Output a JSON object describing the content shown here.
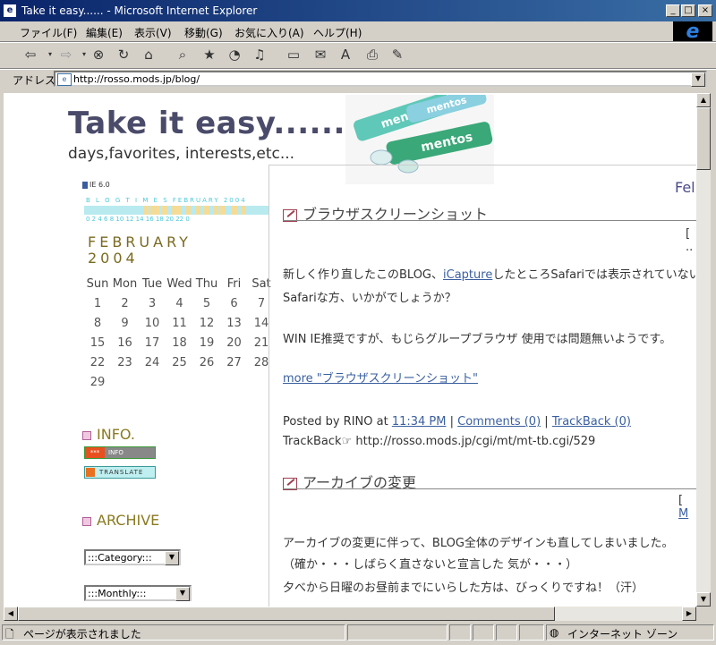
{
  "window": {
    "title": "Take it easy...... - Microsoft Internet Explorer"
  },
  "menu": [
    "ファイル(F)",
    "編集(E)",
    "表示(V)",
    "移動(G)",
    "お気に入り(A)",
    "ヘルプ(H)"
  ],
  "address": {
    "label": "アドレス",
    "url": "http://rosso.mods.jp/blog/"
  },
  "blog": {
    "title": "Take it easy........",
    "subtitle": "days,favorites, interests,etc...",
    "header_image_text": [
      "mentos",
      "mentos",
      "mentos"
    ]
  },
  "sidebar": {
    "ie_badge": "IE 6.0",
    "blogtimes_label": "B L O G T I M E S   FEBRUARY 2004",
    "blogtimes_hours": "0 2 4 6 8 10 12 14 16 18 20 22 0",
    "blogtimes_activity": [
      0.32,
      0.36,
      0.38,
      0.42,
      0.47,
      0.5,
      0.55,
      0.6,
      0.65,
      0.7,
      0.74,
      0.8,
      0.85
    ],
    "calendar_month": "FEBRUARY",
    "calendar_year": "2004",
    "calendar_days": [
      "Sun",
      "Mon",
      "Tue",
      "Wed",
      "Thu",
      "Fri",
      "Sat"
    ],
    "calendar_weeks": [
      [
        "1",
        "2",
        "3",
        "4",
        "5",
        "6",
        "7"
      ],
      [
        "8",
        "9",
        "10",
        "11",
        "12",
        "13",
        "14"
      ],
      [
        "15",
        "16",
        "17",
        "18",
        "19",
        "20",
        "21"
      ],
      [
        "22",
        "23",
        "24",
        "25",
        "26",
        "27",
        "28"
      ],
      [
        "29",
        "",
        "",
        "",
        "",
        "",
        ""
      ]
    ],
    "info_heading": "INFO.",
    "info_button": {
      "left": "***",
      "right": "INFO"
    },
    "translate_button": "TRANSLATE",
    "archive_heading": "ARCHIVE",
    "category_select": ":::Category:::",
    "monthly_select": ":::Monthly:::"
  },
  "main": {
    "date_header": "Fel",
    "entries": [
      {
        "title": "ブラウザスクリーンショット",
        "meta": "[ ..",
        "para1_pre": "新しく作り直したこのBLOG、",
        "para1_link": "iCapture",
        "para1_post": "したところSafariでは表示されていないみたい",
        "para1_line2": "Safariな方、いかがでしょうか？",
        "para2": "WIN IE推奨ですが、もじらグループブラウザ 使用では問題無いようです。",
        "more_link": "more \"ブラウザスクリーンショット\"",
        "posted_by": "Posted by RINO at",
        "time_link": "11:34 PM",
        "comments_link": "Comments (0)",
        "trackback_link": "TrackBack (0)",
        "trackback_label": "TrackBack",
        "trackback_url": "http://rosso.mods.jp/cgi/mt/mt-tb.cgi/529"
      },
      {
        "title": "アーカイブの変更",
        "meta_bracket": "[",
        "meta_link": "M",
        "line1": "アーカイブの変更に伴って、BLOG全体のデザインも直してしまいました。",
        "line2": "（確か・・・しばらく直さないと宣言した 気が・・・）",
        "line3": "夕べから日曜のお昼前までにいらした方は、びっくりですね！（汗）"
      }
    ]
  },
  "status": {
    "text": "ページが表示されました",
    "zone": "インターネット ゾーン"
  }
}
